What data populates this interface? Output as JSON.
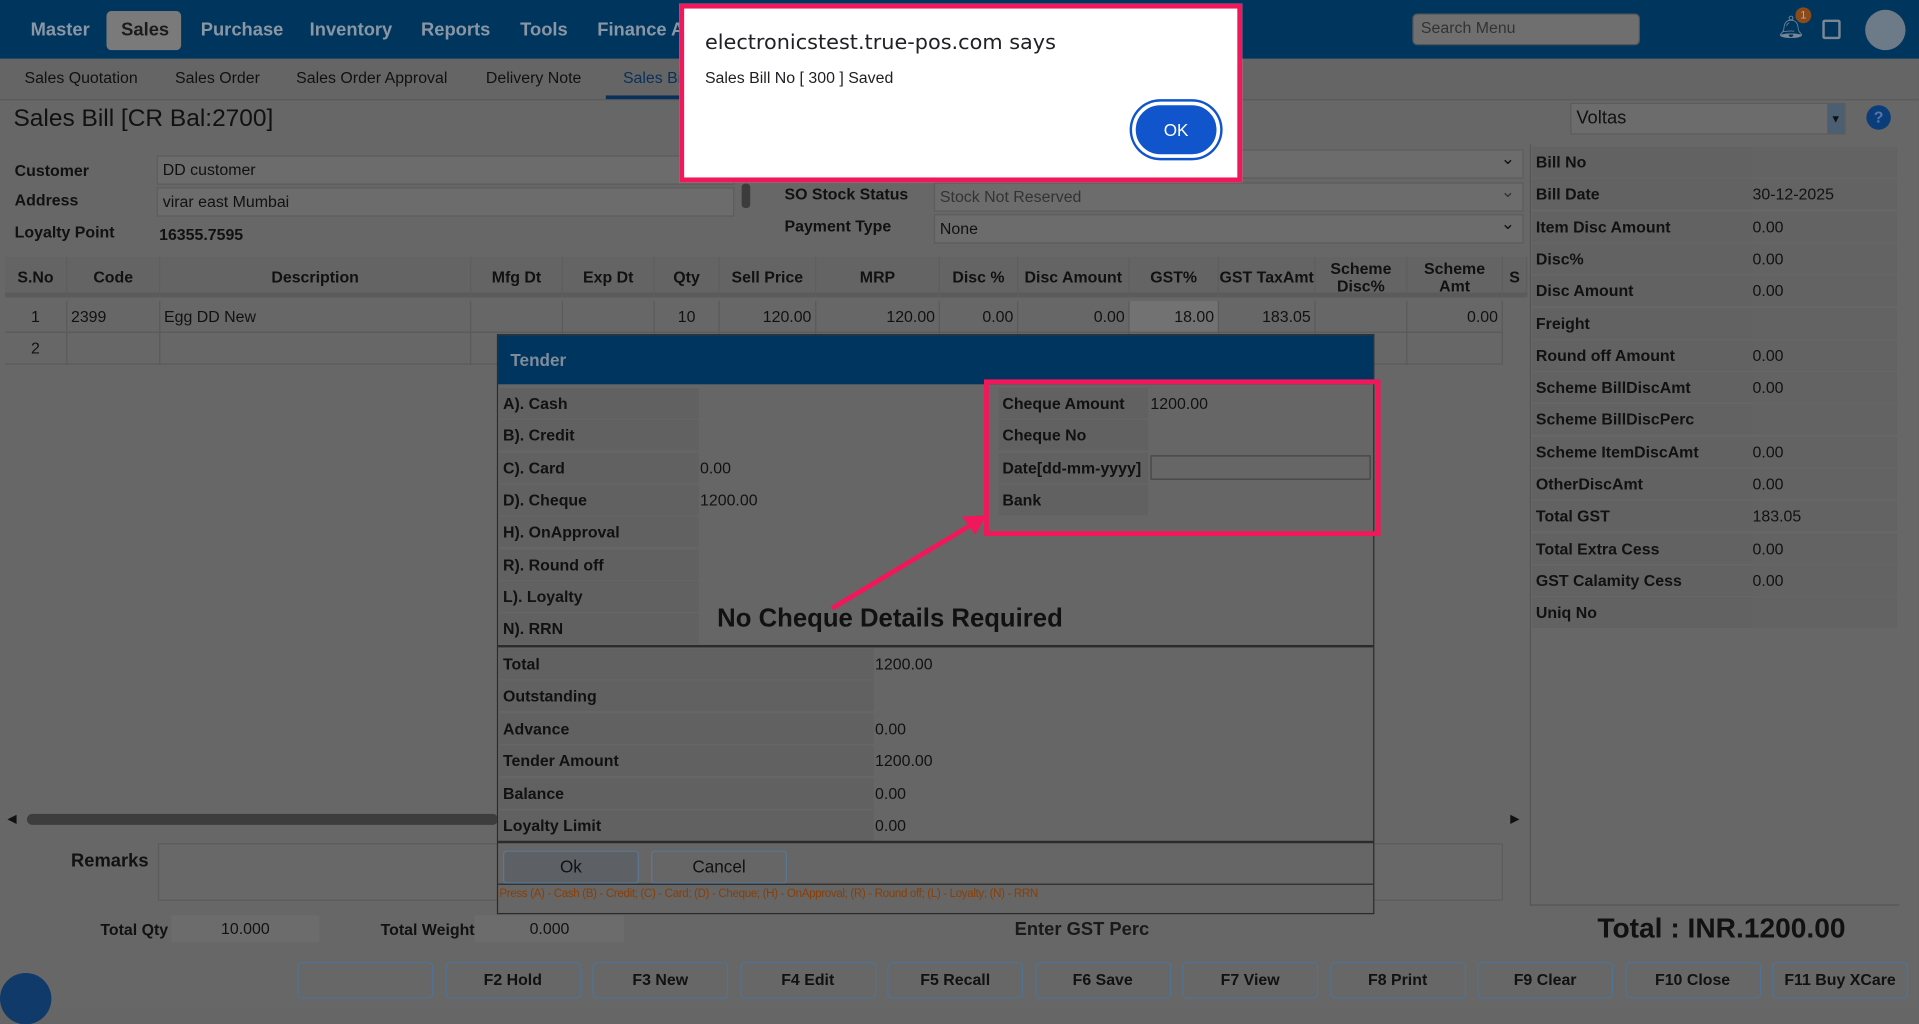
{
  "nav": {
    "items": [
      "Master",
      "Sales",
      "Purchase",
      "Inventory",
      "Reports",
      "Tools",
      "Finance Ar"
    ],
    "active": "Sales",
    "search_placeholder": "Search Menu",
    "notification_count": "1"
  },
  "subnav": {
    "items": [
      "Sales Quotation",
      "Sales Order",
      "Sales Order Approval",
      "Delivery Note",
      "Sales Bi"
    ]
  },
  "page": {
    "title": "Sales Bill [CR Bal:2700]",
    "company": "Voltas",
    "help": "?"
  },
  "customer": {
    "customer_label": "Customer",
    "customer": "DD customer",
    "address_label": "Address",
    "address": "virar east Mumbai",
    "loyalty_label": "Loyalty Point",
    "loyalty": "16355.7595"
  },
  "options": {
    "so_stock_label": "SO Stock Status",
    "so_stock": "Stock Not Reserved",
    "payment_label": "Payment Type",
    "payment": "None"
  },
  "table": {
    "headers": [
      "S.No",
      "Code",
      "Description",
      "Mfg Dt",
      "Exp Dt",
      "Qty",
      "Sell Price",
      "MRP",
      "Disc %",
      "Disc Amount",
      "GST%",
      "GST TaxAmt",
      "Scheme Disc%",
      "Scheme Amt",
      "S"
    ],
    "rows": [
      [
        "1",
        "2399",
        "Egg DD New",
        "",
        "",
        "10",
        "120.00",
        "120.00",
        "0.00",
        "0.00",
        "18.00",
        "183.05",
        "",
        "0.00"
      ],
      [
        "2",
        "",
        "",
        "",
        "",
        "",
        "",
        "",
        "",
        "",
        "",
        "",
        "",
        ""
      ]
    ]
  },
  "summary": [
    [
      "Bill No",
      ""
    ],
    [
      "Bill Date",
      "30-12-2025"
    ],
    [
      "Item Disc Amount",
      "0.00"
    ],
    [
      "Disc%",
      "0.00"
    ],
    [
      "Disc Amount",
      "0.00"
    ],
    [
      "Freight",
      ""
    ],
    [
      "Round off Amount",
      "0.00"
    ],
    [
      "Scheme BillDiscAmt",
      "0.00"
    ],
    [
      "Scheme BillDiscPerc",
      ""
    ],
    [
      "Scheme ItemDiscAmt",
      "0.00"
    ],
    [
      "OtherDiscAmt",
      "0.00"
    ],
    [
      "Total GST",
      "183.05"
    ],
    [
      "Total Extra Cess",
      "0.00"
    ],
    [
      "GST Calamity Cess",
      "0.00"
    ],
    [
      "Uniq No",
      ""
    ]
  ],
  "remarks_label": "Remarks",
  "totals": {
    "qty_label": "Total Qty",
    "qty": "10.000",
    "weight_label": "Total Weight",
    "weight": "0.000",
    "gst_prompt": "Enter GST Perc",
    "total": "Total : INR.1200.00"
  },
  "fkeys": [
    "",
    "F2 Hold",
    "F3 New",
    "F4 Edit",
    "F5 Recall",
    "F6 Save",
    "F7 View",
    "F8 Print",
    "F9 Clear",
    "F10 Close",
    "F11 Buy XCare"
  ],
  "tender": {
    "title": "Tender",
    "modes": [
      [
        "A). Cash",
        ""
      ],
      [
        "B). Credit",
        ""
      ],
      [
        "C). Card",
        "0.00"
      ],
      [
        "D). Cheque",
        "1200.00"
      ],
      [
        "H). OnApproval",
        ""
      ],
      [
        "R). Round off",
        ""
      ],
      [
        "L). Loyalty",
        ""
      ],
      [
        "N). RRN",
        ""
      ]
    ],
    "cheque": [
      [
        "Cheque Amount",
        "1200.00"
      ],
      [
        "Cheque No",
        ""
      ],
      [
        "Date[dd-mm-yyyy]",
        ""
      ],
      [
        "Bank",
        ""
      ]
    ],
    "totals": [
      [
        "Total",
        "1200.00"
      ],
      [
        "Outstanding",
        ""
      ],
      [
        "Advance",
        "0.00"
      ],
      [
        "Tender Amount",
        "1200.00"
      ],
      [
        "Balance",
        "0.00"
      ],
      [
        "Loyalty Limit",
        "0.00"
      ]
    ],
    "ok": "Ok",
    "cancel": "Cancel",
    "hint": "Press (A) - Cash (B) - Credit; (C) - Card; (D) - Cheque; (H) - OnApproval; (R) - Round off; (L) - Loyalty; (N) - RRN"
  },
  "annotation": "No Cheque Details Required",
  "alert": {
    "origin": "electronicstest.true-pos.com says",
    "message": "Sales Bill No [ 300 ] Saved",
    "ok": "OK"
  },
  "colors": {
    "nav": "#00365e",
    "highlight": "#f0185a",
    "ok_button": "#1155cc"
  }
}
